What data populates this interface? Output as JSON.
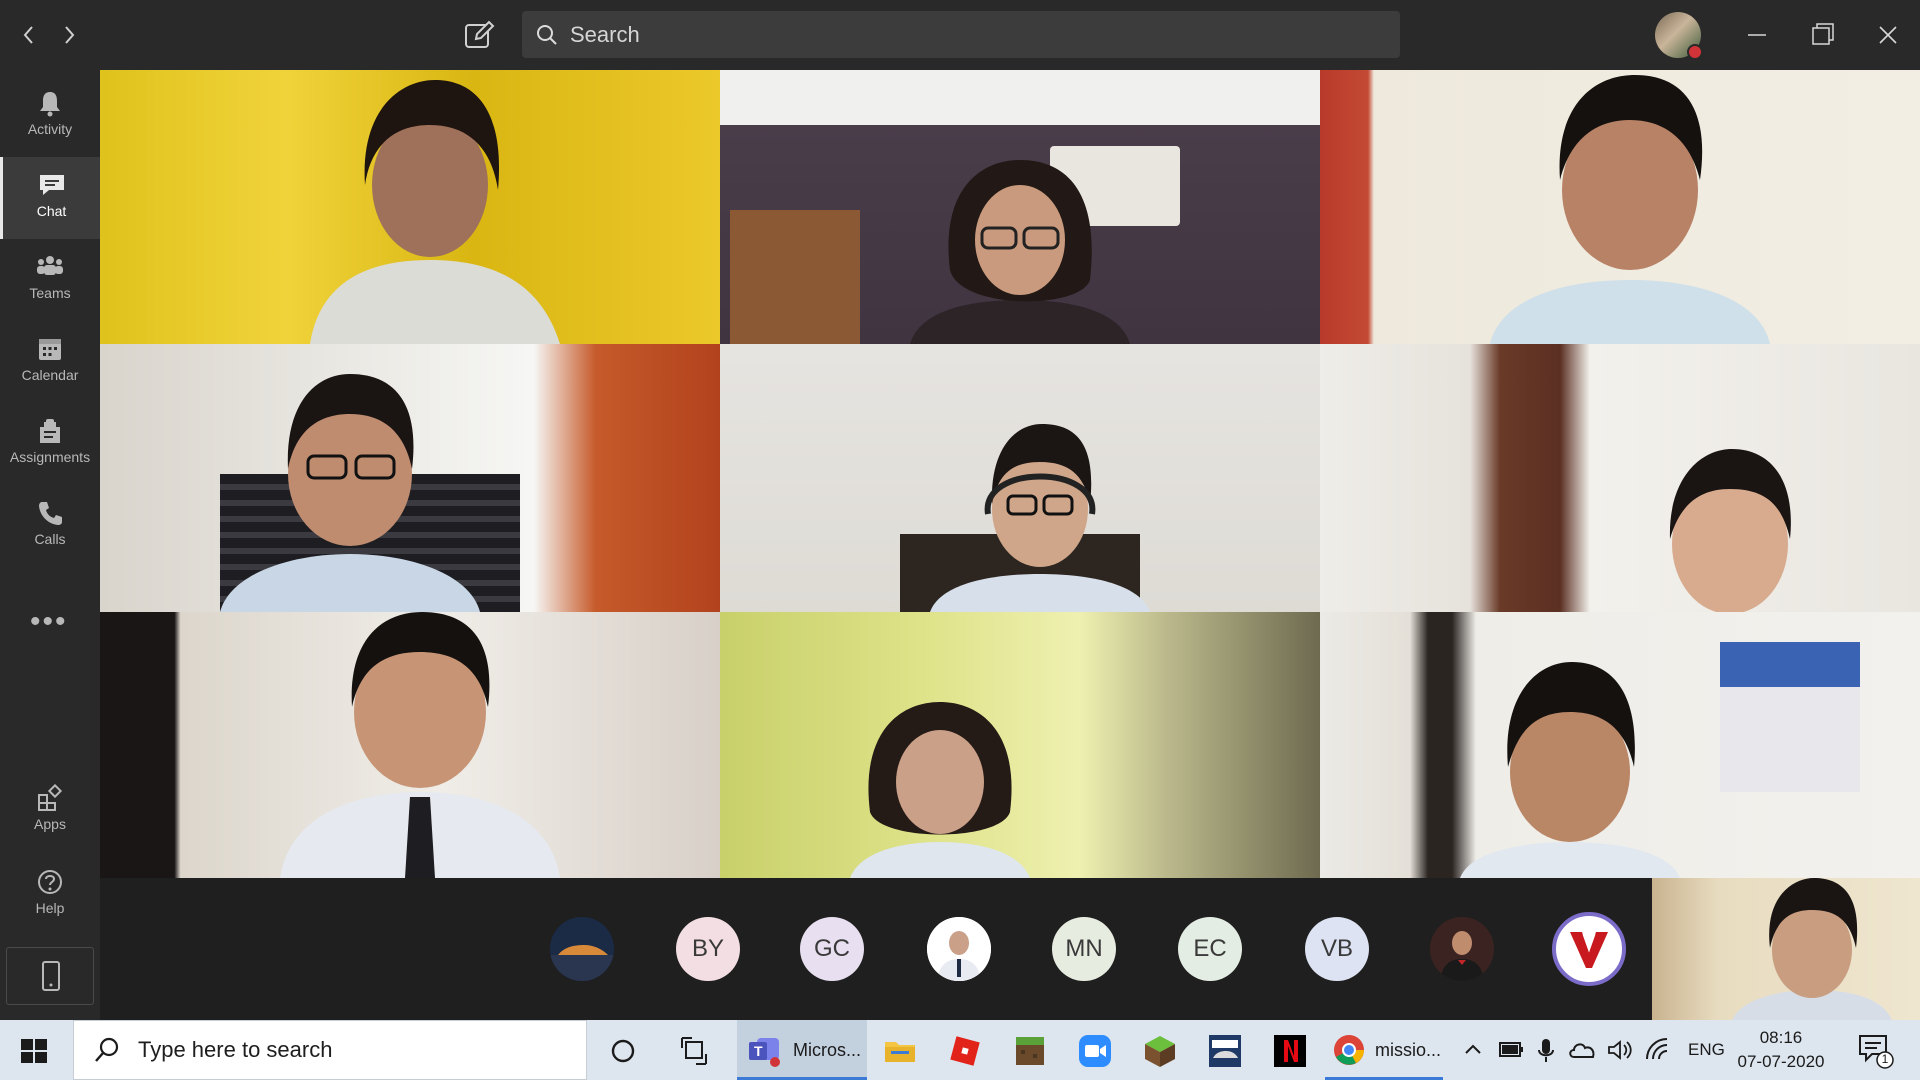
{
  "search": {
    "placeholder": "Search"
  },
  "rail": {
    "items": [
      {
        "label": "Activity",
        "icon": "bell-icon"
      },
      {
        "label": "Chat",
        "icon": "chat-icon",
        "active": true
      },
      {
        "label": "Teams",
        "icon": "teams-icon"
      },
      {
        "label": "Calendar",
        "icon": "calendar-icon"
      },
      {
        "label": "Assignments",
        "icon": "assignments-icon"
      },
      {
        "label": "Calls",
        "icon": "phone-icon"
      }
    ],
    "more": "•••",
    "apps_label": "Apps",
    "help_label": "Help"
  },
  "roster": [
    {
      "initials": "",
      "bg": "#1b2a45",
      "kind": "photo-car"
    },
    {
      "initials": "BY",
      "bg": "#f3dfe3"
    },
    {
      "initials": "GC",
      "bg": "#e8e0f0"
    },
    {
      "initials": "",
      "bg": "#ffffff",
      "kind": "photo-student"
    },
    {
      "initials": "MN",
      "bg": "#e6ece0"
    },
    {
      "initials": "EC",
      "bg": "#e4ede4"
    },
    {
      "initials": "VB",
      "bg": "#dde3f3"
    },
    {
      "initials": "",
      "bg": "#3a2320",
      "kind": "photo-man"
    },
    {
      "initials": "",
      "bg": "#ffffff",
      "kind": "logo"
    }
  ],
  "taskbar": {
    "search_placeholder": "Type here to search",
    "teams_label": "Micros...",
    "chrome_label": "missio...",
    "language": "ENG",
    "time": "08:16",
    "date": "07-07-2020",
    "notification_count": "1"
  },
  "colors": {
    "titlebar": "#292929",
    "rail": "#292929",
    "accent_status": "#d13438",
    "taskbar": "#dde5ee"
  }
}
